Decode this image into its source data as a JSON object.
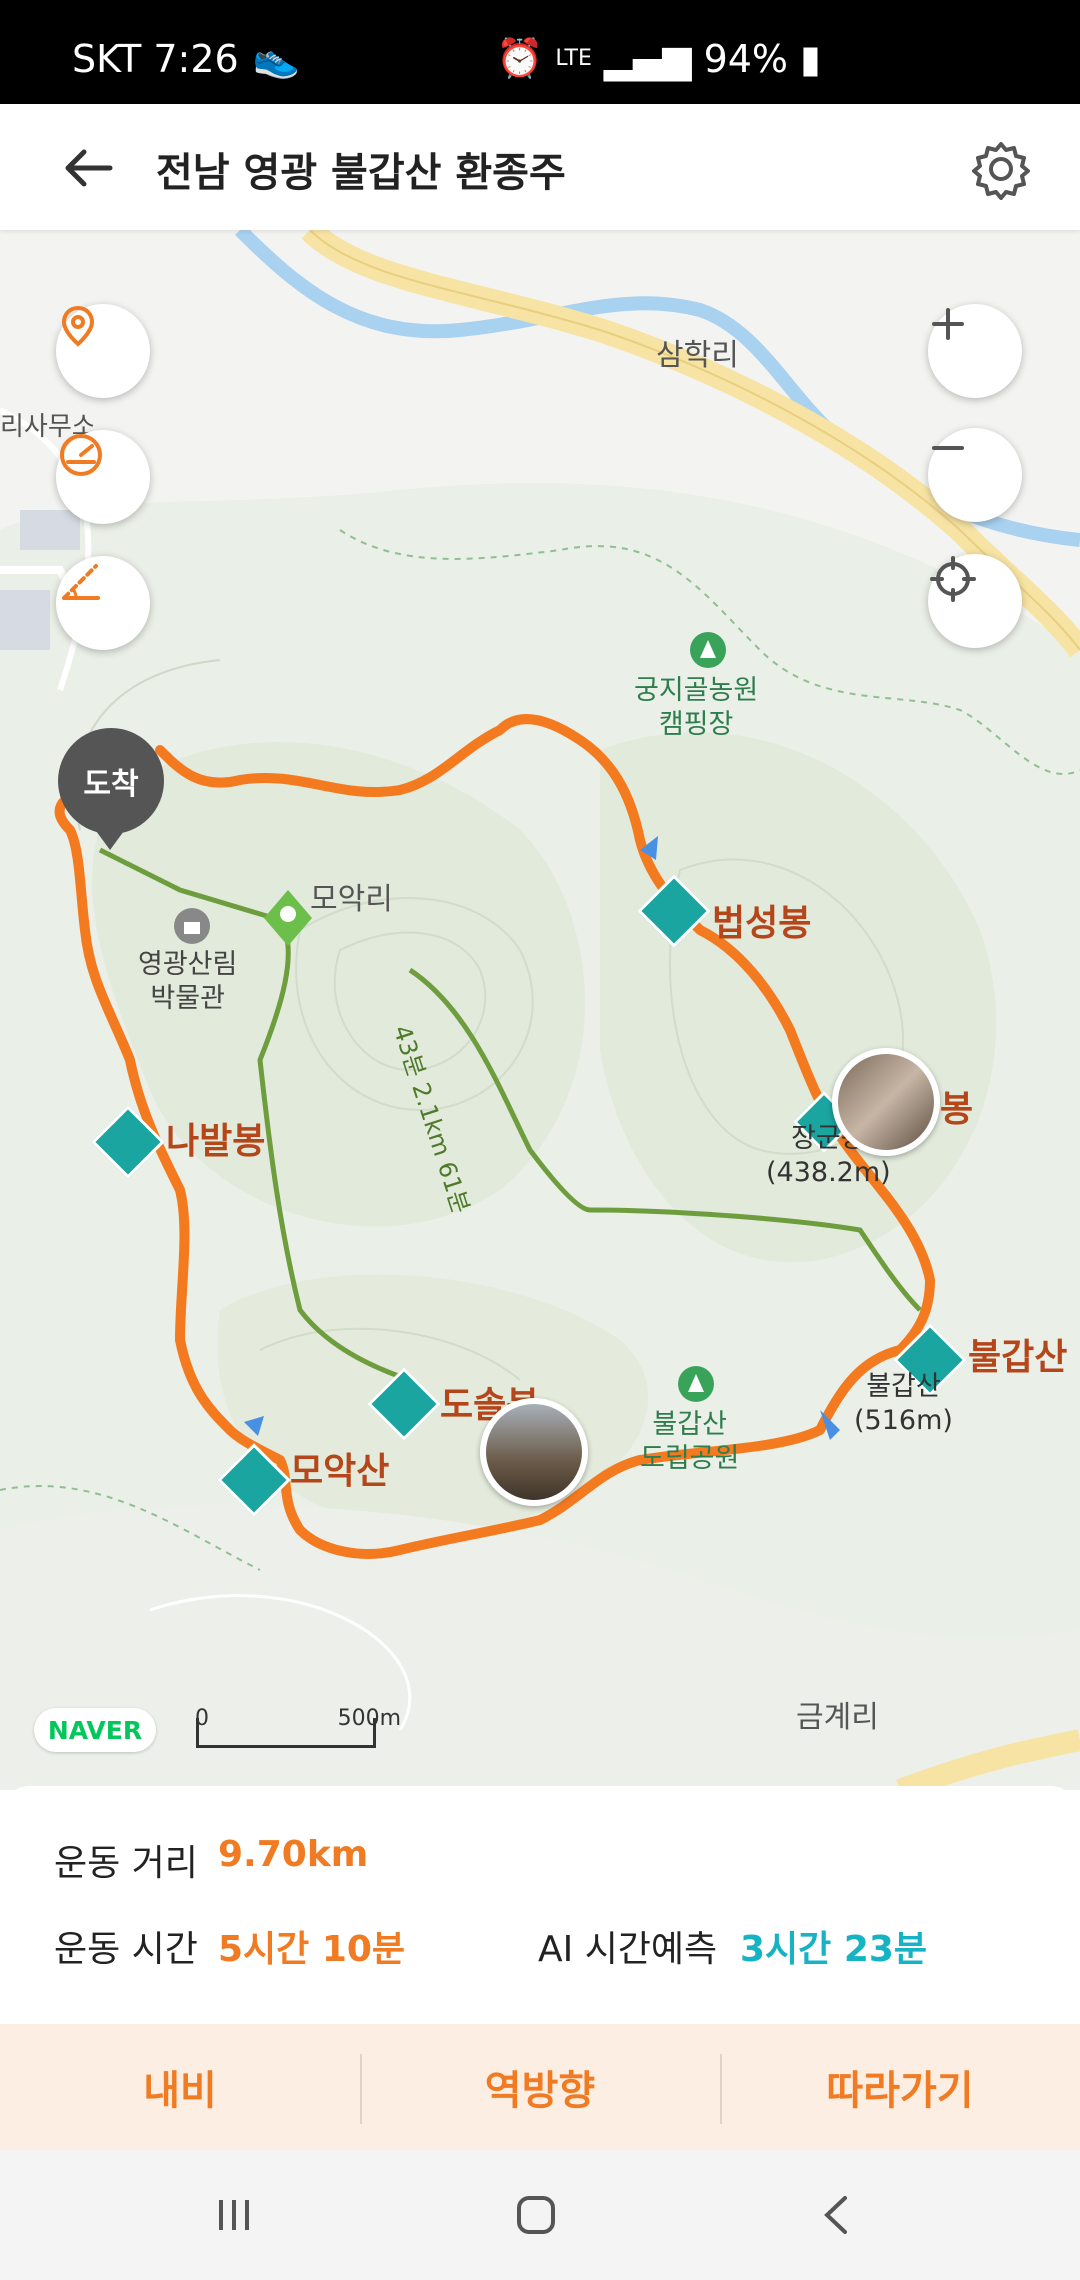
{
  "status_bar": {
    "carrier_time": "SKT 7:26",
    "network": "LTE",
    "battery": "94%"
  },
  "app_bar": {
    "title": "전남  영광 불갑산 환종주"
  },
  "map": {
    "labels": {
      "samhak": "삼학리",
      "office": "리사무소",
      "moak_village": "모악리",
      "geumgye": "금계리"
    },
    "pois": {
      "camping": "궁지골농원\n캠핑장",
      "museum": "영광산림\n박물관",
      "park": "불갑산\n도립공원"
    },
    "peaks": {
      "beopseong": "법성봉",
      "nabal": "나발봉",
      "moak": "모악산",
      "doseol": "도솔봉",
      "bulgap": "불갑산",
      "janggun": "봉"
    },
    "peak_subs": {
      "janggun_sub": "장군봉\n(438.2m)",
      "bulgap_sub": "불갑산\n(516m)"
    },
    "trail_label": "43분 2.1km 61분",
    "arrive": "도착",
    "logo": "NAVER",
    "scale_zero": "0",
    "scale_max": "500m"
  },
  "stats": {
    "distance_label": "운동 거리",
    "distance_value": "9.70km",
    "time_label": "운동 시간",
    "time_value": "5시간 10분",
    "ai_label": "AI 시간예측",
    "ai_value": "3시간 23분"
  },
  "actions": {
    "navigate": "내비",
    "reverse": "역방향",
    "follow": "따라가기"
  },
  "colors": {
    "route": "#f47a20",
    "accent_orange": "#f07b22",
    "accent_teal": "#15b3c4",
    "peak_icon": "#1aa5a0",
    "trail_green": "#6e9d3e"
  }
}
